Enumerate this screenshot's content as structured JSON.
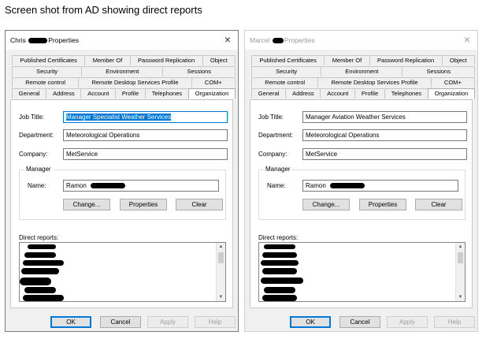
{
  "caption": "Screen shot from AD showing direct reports",
  "tab_rows": [
    [
      "Published Certificates",
      "Member Of",
      "Password Replication",
      "Object"
    ],
    [
      "Security",
      "Environment",
      "Sessions"
    ],
    [
      "Remote control",
      "Remote Desktop Services Profile",
      "COM+"
    ],
    [
      "General",
      "Address",
      "Account",
      "Profile",
      "Telephones",
      "Organization"
    ]
  ],
  "labels": {
    "job_title": "Job Title:",
    "department": "Department:",
    "company": "Company:",
    "manager_group": "Manager",
    "name": "Name:",
    "direct_reports": "Direct reports:"
  },
  "buttons": {
    "change": "Change...",
    "properties": "Properties",
    "clear": "Clear",
    "ok": "OK",
    "cancel": "Cancel",
    "apply": "Apply",
    "help": "Help"
  },
  "dialogs": [
    {
      "title_prefix": "Chris",
      "title_suffix": "Properties",
      "close_icon": "×",
      "job_title": "Manager Specialist Weather Services",
      "department": "Meteorological Operations",
      "company": "MetService",
      "manager_name": "Ramon",
      "active_tab": "Organization"
    },
    {
      "title_prefix": "Marcel",
      "title_suffix": "Properties",
      "close_icon": "×",
      "job_title": "Manager Aviation Weather Services",
      "department": "Meteorological Operations",
      "company": "MetService",
      "manager_name": "Ramon",
      "active_tab": "Organization"
    }
  ],
  "colors": {
    "dialog_bg": "#f0f0f0",
    "accent": "#0078d7",
    "redaction": "#000000"
  }
}
